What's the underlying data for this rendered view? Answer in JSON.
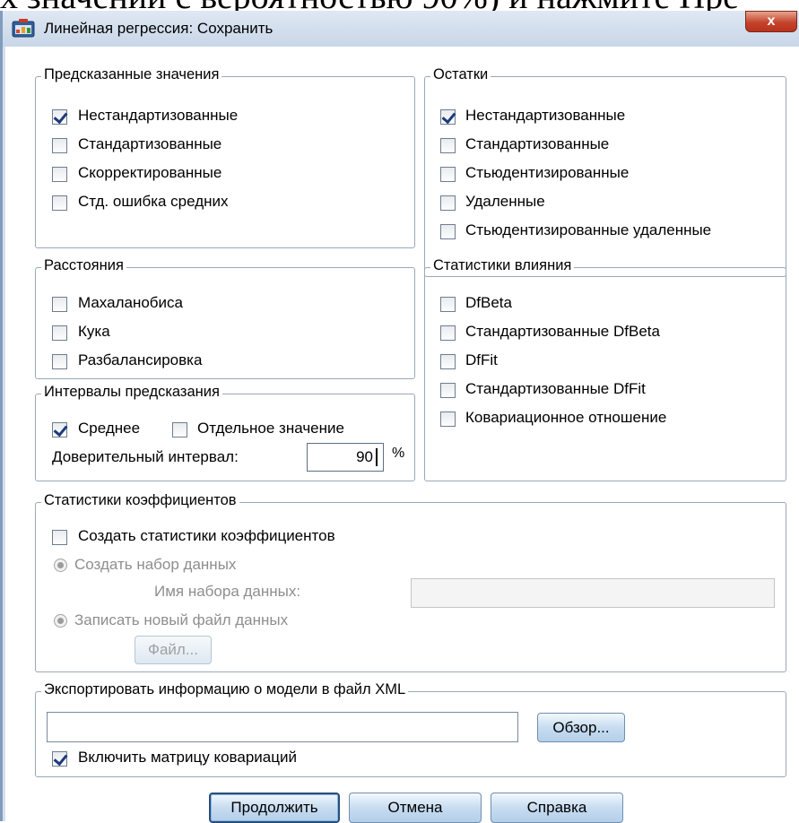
{
  "background_text": "х значений с вероятностью 90%) и нажмите  Пре",
  "window": {
    "title": "Линейная регрессия: Сохранить",
    "close_label": "x"
  },
  "predicted": {
    "legend": "Предсказанные значения",
    "items": [
      {
        "label": "Нестандартизованные",
        "checked": true
      },
      {
        "label": "Стандартизованные",
        "checked": false
      },
      {
        "label": "Скорректированные",
        "checked": false
      },
      {
        "label": "Стд. ошибка средних",
        "checked": false
      }
    ]
  },
  "residuals": {
    "legend": "Остатки",
    "items": [
      {
        "label": "Нестандартизованные",
        "checked": true
      },
      {
        "label": "Стандартизованные",
        "checked": false
      },
      {
        "label": "Стьюдентизированные",
        "checked": false
      },
      {
        "label": "Удаленные",
        "checked": false
      },
      {
        "label": "Стьюдентизированные удаленные",
        "checked": false
      }
    ]
  },
  "distances": {
    "legend": "Расстояния",
    "items": [
      {
        "label": "Махаланобиса",
        "checked": false
      },
      {
        "label": "Кука",
        "checked": false
      },
      {
        "label": "Разбалансировка",
        "checked": false
      }
    ]
  },
  "influence": {
    "legend": "Статистики влияния",
    "items": [
      {
        "label": "DfBeta",
        "checked": false
      },
      {
        "label": "Стандартизованные DfBeta",
        "checked": false
      },
      {
        "label": "DfFit",
        "checked": false
      },
      {
        "label": "Стандартизованные DfFit",
        "checked": false
      },
      {
        "label": "Ковариационное отношение",
        "checked": false
      }
    ]
  },
  "intervals": {
    "legend": "Интервалы предсказания",
    "mean_label": "Среднее",
    "mean_checked": true,
    "individual_label": "Отдельное значение",
    "individual_checked": false,
    "confidence_label": "Доверительный интервал:",
    "confidence_value": "90",
    "percent": "%"
  },
  "coef": {
    "legend": "Статистики коэффициентов",
    "create_label": "Создать статистики коэффициентов",
    "create_checked": false,
    "dataset_radio": "Создать набор данных",
    "dataset_name_label": "Имя набора данных:",
    "newfile_radio": "Записать новый файл данных",
    "file_button": "Файл..."
  },
  "xml": {
    "legend": "Экспортировать информацию о модели в файл XML",
    "path_value": "",
    "browse_button": "Обзор...",
    "cov_label": "Включить матрицу ковариаций",
    "cov_checked": true
  },
  "buttons": {
    "continue": "Продолжить",
    "cancel": "Отмена",
    "help": "Справка"
  }
}
